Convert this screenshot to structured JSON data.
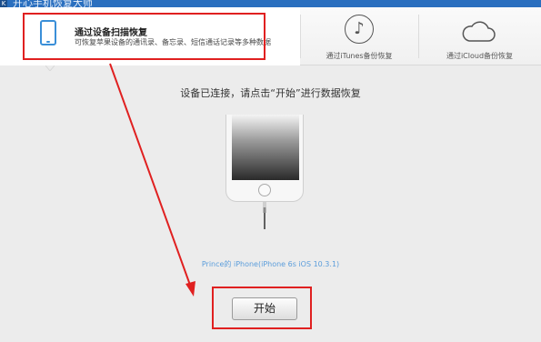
{
  "window": {
    "title": "开心手机恢复大师",
    "logo_icon": "app-logo-icon"
  },
  "tabs": [
    {
      "id": "scan",
      "title": "通过设备扫描恢复",
      "description": "可恢复苹果设备的通讯录、备忘录、短信通话记录等多种数据",
      "icon": "phone-icon",
      "selected": true
    },
    {
      "id": "itunes",
      "label": "通过iTunes备份恢复",
      "icon": "music-note-icon",
      "selected": false
    },
    {
      "id": "icloud",
      "label": "通过iCloud备份恢复",
      "icon": "cloud-icon",
      "selected": false
    }
  ],
  "main": {
    "status": "设备已连接，请点击“开始”进行数据恢复",
    "device_name": "Prince的 iPhone(iPhone 6s iOS 10.3.1)",
    "start_label": "开始"
  },
  "colors": {
    "accent": "#3a8fd8",
    "highlight": "#e02020",
    "device_text": "#5b9ddb",
    "background": "#ececec"
  }
}
